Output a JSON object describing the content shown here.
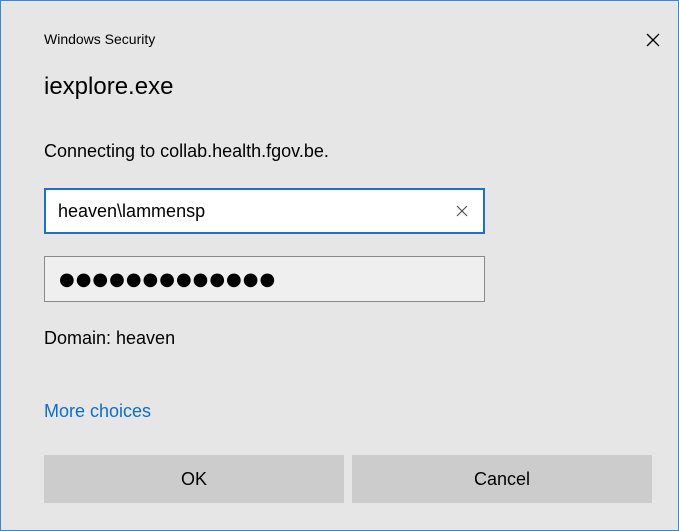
{
  "dialog": {
    "caption": "Windows Security",
    "app_title": "iexplore.exe",
    "message": "Connecting to collab.health.fgov.be."
  },
  "username": {
    "value": "heaven\\lammensp"
  },
  "password": {
    "masked_value": "●●●●●●●●●●●●●"
  },
  "domain_text": "Domain: heaven",
  "links": {
    "more_choices": "More choices"
  },
  "buttons": {
    "ok_label": "OK",
    "cancel_label": "Cancel"
  },
  "icons": {
    "close": "close-icon",
    "clear": "clear-icon"
  },
  "colors": {
    "dialog_background": "#e6e6e6",
    "dialog_border": "#3c86d6",
    "focused_input_border": "#1a73c8",
    "link": "#0b6fc9",
    "button_background": "#cccccc"
  }
}
